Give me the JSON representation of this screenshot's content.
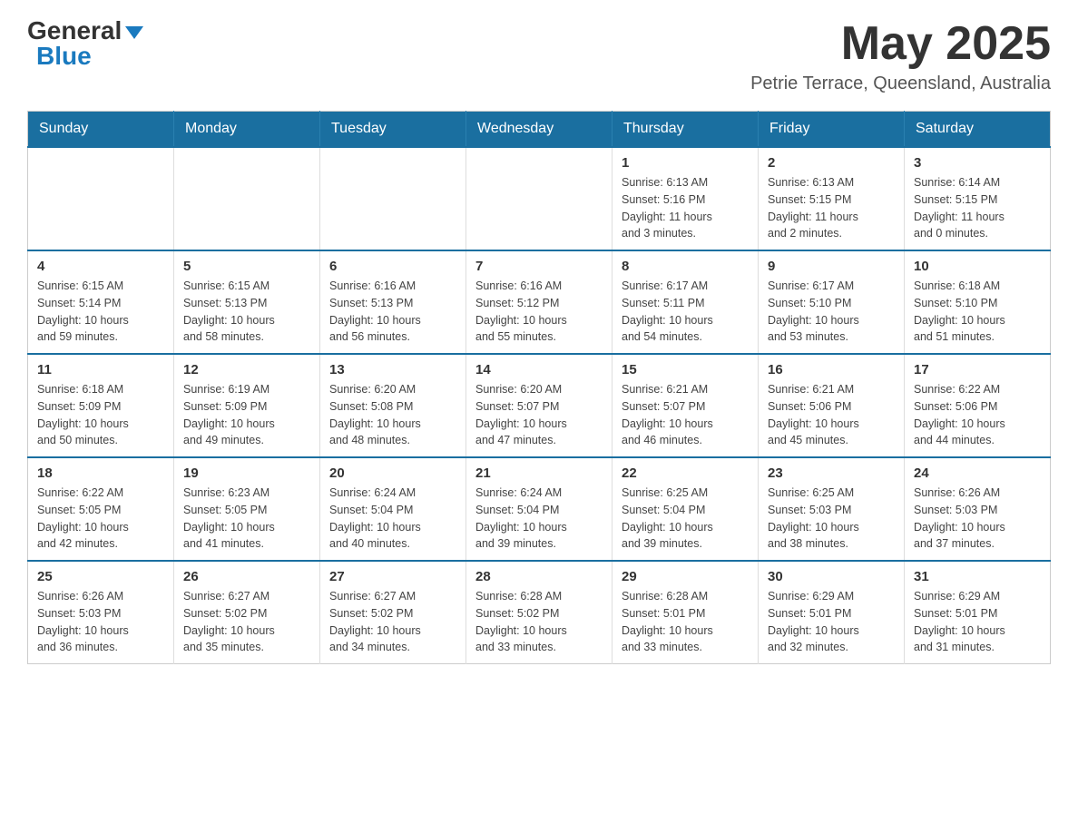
{
  "header": {
    "logo_general": "General",
    "logo_blue": "Blue",
    "month_title": "May 2025",
    "location": "Petrie Terrace, Queensland, Australia"
  },
  "calendar": {
    "days_of_week": [
      "Sunday",
      "Monday",
      "Tuesday",
      "Wednesday",
      "Thursday",
      "Friday",
      "Saturday"
    ],
    "weeks": [
      [
        {
          "day": "",
          "info": ""
        },
        {
          "day": "",
          "info": ""
        },
        {
          "day": "",
          "info": ""
        },
        {
          "day": "",
          "info": ""
        },
        {
          "day": "1",
          "info": "Sunrise: 6:13 AM\nSunset: 5:16 PM\nDaylight: 11 hours\nand 3 minutes."
        },
        {
          "day": "2",
          "info": "Sunrise: 6:13 AM\nSunset: 5:15 PM\nDaylight: 11 hours\nand 2 minutes."
        },
        {
          "day": "3",
          "info": "Sunrise: 6:14 AM\nSunset: 5:15 PM\nDaylight: 11 hours\nand 0 minutes."
        }
      ],
      [
        {
          "day": "4",
          "info": "Sunrise: 6:15 AM\nSunset: 5:14 PM\nDaylight: 10 hours\nand 59 minutes."
        },
        {
          "day": "5",
          "info": "Sunrise: 6:15 AM\nSunset: 5:13 PM\nDaylight: 10 hours\nand 58 minutes."
        },
        {
          "day": "6",
          "info": "Sunrise: 6:16 AM\nSunset: 5:13 PM\nDaylight: 10 hours\nand 56 minutes."
        },
        {
          "day": "7",
          "info": "Sunrise: 6:16 AM\nSunset: 5:12 PM\nDaylight: 10 hours\nand 55 minutes."
        },
        {
          "day": "8",
          "info": "Sunrise: 6:17 AM\nSunset: 5:11 PM\nDaylight: 10 hours\nand 54 minutes."
        },
        {
          "day": "9",
          "info": "Sunrise: 6:17 AM\nSunset: 5:10 PM\nDaylight: 10 hours\nand 53 minutes."
        },
        {
          "day": "10",
          "info": "Sunrise: 6:18 AM\nSunset: 5:10 PM\nDaylight: 10 hours\nand 51 minutes."
        }
      ],
      [
        {
          "day": "11",
          "info": "Sunrise: 6:18 AM\nSunset: 5:09 PM\nDaylight: 10 hours\nand 50 minutes."
        },
        {
          "day": "12",
          "info": "Sunrise: 6:19 AM\nSunset: 5:09 PM\nDaylight: 10 hours\nand 49 minutes."
        },
        {
          "day": "13",
          "info": "Sunrise: 6:20 AM\nSunset: 5:08 PM\nDaylight: 10 hours\nand 48 minutes."
        },
        {
          "day": "14",
          "info": "Sunrise: 6:20 AM\nSunset: 5:07 PM\nDaylight: 10 hours\nand 47 minutes."
        },
        {
          "day": "15",
          "info": "Sunrise: 6:21 AM\nSunset: 5:07 PM\nDaylight: 10 hours\nand 46 minutes."
        },
        {
          "day": "16",
          "info": "Sunrise: 6:21 AM\nSunset: 5:06 PM\nDaylight: 10 hours\nand 45 minutes."
        },
        {
          "day": "17",
          "info": "Sunrise: 6:22 AM\nSunset: 5:06 PM\nDaylight: 10 hours\nand 44 minutes."
        }
      ],
      [
        {
          "day": "18",
          "info": "Sunrise: 6:22 AM\nSunset: 5:05 PM\nDaylight: 10 hours\nand 42 minutes."
        },
        {
          "day": "19",
          "info": "Sunrise: 6:23 AM\nSunset: 5:05 PM\nDaylight: 10 hours\nand 41 minutes."
        },
        {
          "day": "20",
          "info": "Sunrise: 6:24 AM\nSunset: 5:04 PM\nDaylight: 10 hours\nand 40 minutes."
        },
        {
          "day": "21",
          "info": "Sunrise: 6:24 AM\nSunset: 5:04 PM\nDaylight: 10 hours\nand 39 minutes."
        },
        {
          "day": "22",
          "info": "Sunrise: 6:25 AM\nSunset: 5:04 PM\nDaylight: 10 hours\nand 39 minutes."
        },
        {
          "day": "23",
          "info": "Sunrise: 6:25 AM\nSunset: 5:03 PM\nDaylight: 10 hours\nand 38 minutes."
        },
        {
          "day": "24",
          "info": "Sunrise: 6:26 AM\nSunset: 5:03 PM\nDaylight: 10 hours\nand 37 minutes."
        }
      ],
      [
        {
          "day": "25",
          "info": "Sunrise: 6:26 AM\nSunset: 5:03 PM\nDaylight: 10 hours\nand 36 minutes."
        },
        {
          "day": "26",
          "info": "Sunrise: 6:27 AM\nSunset: 5:02 PM\nDaylight: 10 hours\nand 35 minutes."
        },
        {
          "day": "27",
          "info": "Sunrise: 6:27 AM\nSunset: 5:02 PM\nDaylight: 10 hours\nand 34 minutes."
        },
        {
          "day": "28",
          "info": "Sunrise: 6:28 AM\nSunset: 5:02 PM\nDaylight: 10 hours\nand 33 minutes."
        },
        {
          "day": "29",
          "info": "Sunrise: 6:28 AM\nSunset: 5:01 PM\nDaylight: 10 hours\nand 33 minutes."
        },
        {
          "day": "30",
          "info": "Sunrise: 6:29 AM\nSunset: 5:01 PM\nDaylight: 10 hours\nand 32 minutes."
        },
        {
          "day": "31",
          "info": "Sunrise: 6:29 AM\nSunset: 5:01 PM\nDaylight: 10 hours\nand 31 minutes."
        }
      ]
    ]
  }
}
